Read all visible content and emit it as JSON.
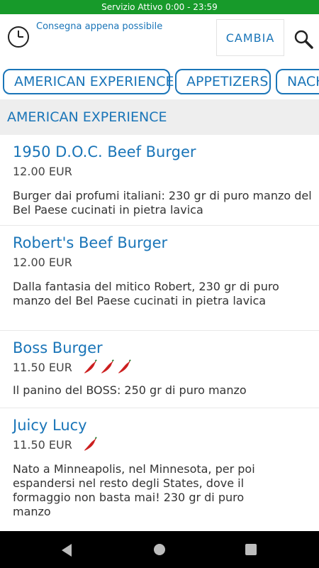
{
  "status_bar": {
    "text": "Servizio Attivo  0:00 - 23:59",
    "color": "#179a2a"
  },
  "header": {
    "delivery_text": "Consegna appena possibile",
    "change_label": "CAMBIA",
    "icons": [
      "clock-icon",
      "search-icon"
    ]
  },
  "categories": [
    {
      "label": "AMERICAN EXPERIENCE"
    },
    {
      "label": "APPETIZERS"
    },
    {
      "label": "NACH"
    }
  ],
  "section": {
    "title": "AMERICAN EXPERIENCE"
  },
  "items": [
    {
      "name": "1950 D.O.C. Beef Burger",
      "price": "12.00 EUR",
      "chilis": 0,
      "description": "Burger dai profumi italiani: 230 gr di puro manzo del Bel Paese cucinati in pietra lavica"
    },
    {
      "name": "Robert's Beef Burger",
      "price": "12.00 EUR",
      "chilis": 0,
      "description": "Dalla fantasia del mitico Robert, 230 gr di puro manzo del Bel Paese cucinati in pietra lavica"
    },
    {
      "name": "Boss Burger",
      "price": "11.50 EUR",
      "chilis": 3,
      "description": "Il panino del BOSS: 250 gr di puro manzo"
    },
    {
      "name": "Juicy Lucy",
      "price": "11.50 EUR",
      "chilis": 1,
      "description": "Nato a Minneapolis, nel Minnesota, per poi espandersi nel resto degli States, dove il formaggio non basta mai! 230 gr di puro manzo"
    }
  ],
  "colors": {
    "accent": "#1a75b8",
    "chili": "#cc1f1f"
  }
}
